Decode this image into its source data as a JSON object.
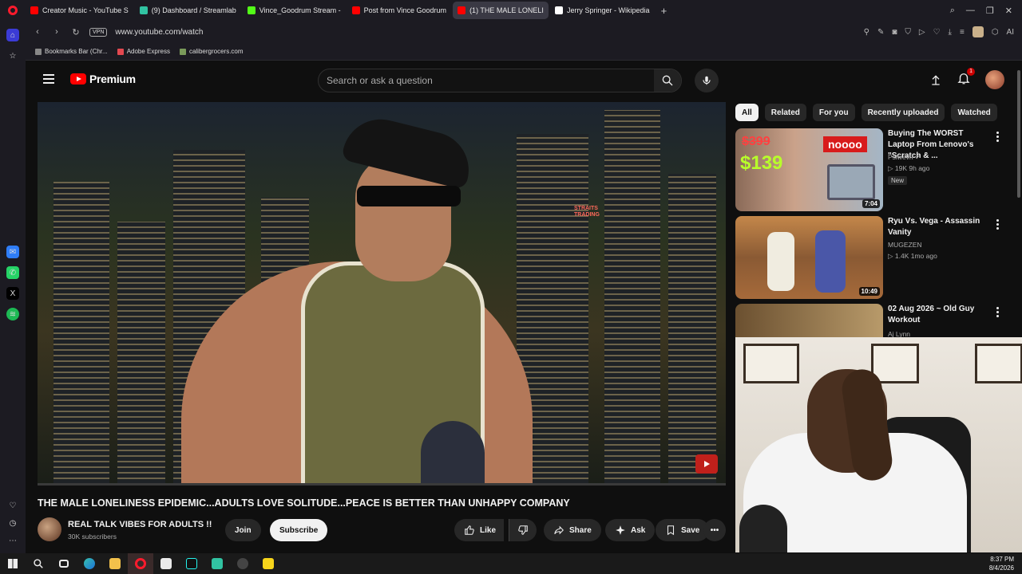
{
  "browser": {
    "tabs": [
      {
        "label": "Creator Music - YouTube S",
        "color": "#ff0000"
      },
      {
        "label": "(9) Dashboard / Streamlab",
        "color": "#31c3a2"
      },
      {
        "label": "Vince_Goodrum Stream -",
        "color": "#53fc18"
      },
      {
        "label": "Post from Vince Goodrum",
        "color": "#ff0000"
      },
      {
        "label": "(1) THE MALE LONELI",
        "color": "#ff0000",
        "active": true
      },
      {
        "label": "Jerry Springer - Wikipedia",
        "color": "#ffffff"
      }
    ],
    "url": "www.youtube.com/watch",
    "vpn_label": "VPN",
    "ai_label": "AI",
    "bookmarks": [
      "Bookmarks Bar (Chr...",
      "Adobe Express",
      "calibergrocers.com"
    ]
  },
  "youtube": {
    "logo_text": "Premium",
    "search_placeholder": "Search or ask a question",
    "notification_count": "1",
    "video": {
      "title": "THE MALE LONELINESS EPIDEMIC...ADULTS LOVE SOLITUDE...PEACE IS BETTER THAN UNHAPPY COMPANY",
      "overlay_text": "STRAITS TRADING",
      "channel_name": "REAL TALK VIBES FOR ADULTS !!",
      "subscribers": "30K subscribers",
      "join_label": "Join",
      "subscribe_label": "Subscribe",
      "like_label": "Like",
      "share_label": "Share",
      "ask_label": "Ask",
      "save_label": "Save"
    },
    "chips": [
      "All",
      "Related",
      "For you",
      "Recently uploaded",
      "Watched"
    ],
    "recommendations": [
      {
        "title": "Buying The WORST Laptop From Lenovo's \"Scratch & ...",
        "channel": "Psiwevri",
        "meta": "▷ 19K  9h ago",
        "badge": "New",
        "duration": "7:04",
        "thumb_texts": {
          "old_price": "$399",
          "new_price": "$139",
          "caption": "noooo"
        }
      },
      {
        "title": "Ryu Vs. Vega - Assassin Vanity",
        "channel": "MUGEZEN",
        "meta": "▷ 1.4K  1mo ago",
        "duration": "10:49"
      },
      {
        "title": "02 Aug 2026 ~ Old Guy Workout",
        "channel": "Aj Lynn"
      }
    ]
  },
  "taskbar": {
    "time": "8:37 PM",
    "date": "8/4/2026"
  }
}
